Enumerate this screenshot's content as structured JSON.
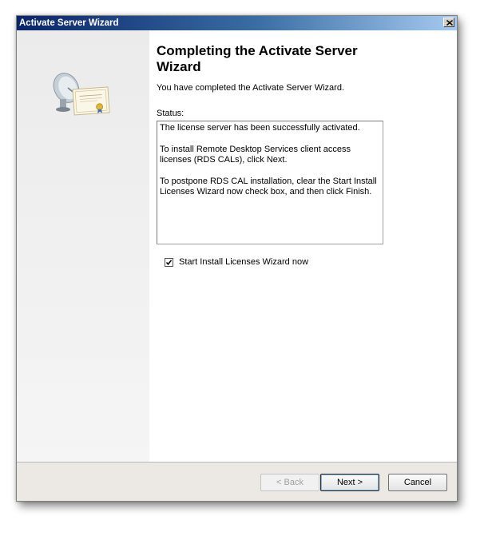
{
  "window": {
    "title": "Activate Server Wizard"
  },
  "header": {
    "title": "Completing the Activate Server Wizard",
    "subtitle": "You have completed the Activate Server Wizard."
  },
  "status": {
    "label": "Status:",
    "lines": [
      "The license server has been successfully activated.",
      "To install Remote Desktop Services client access licenses (RDS CALs), click Next.",
      "To postpone RDS CAL installation, clear the Start Install Licenses Wizard now check box, and then click Finish."
    ]
  },
  "checkbox": {
    "label": "Start Install Licenses Wizard now",
    "checked": true
  },
  "buttons": {
    "back": "< Back",
    "next": "Next >",
    "cancel": "Cancel"
  },
  "icons": {
    "close": "close-icon",
    "art": "satellite-certificate-icon",
    "check": "checkmark-icon"
  }
}
